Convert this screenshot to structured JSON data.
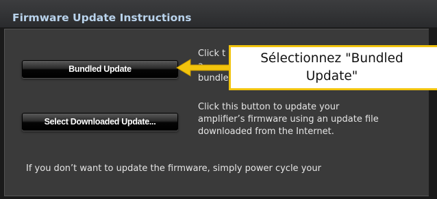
{
  "window": {
    "title": "Firmware Update Instructions"
  },
  "buttons": {
    "bundled_update": "Bundled Update",
    "select_downloaded_update": "Select Downloaded Update..."
  },
  "instructions": {
    "bundled_lines": [
      "Click t",
      "a",
      "bundle"
    ],
    "download_lines": [
      "Click this button to update your",
      "amplifier’s firmware using an update file",
      "downloaded from the Internet."
    ],
    "footer": "If you don’t want to update the firmware, simply power cycle your"
  },
  "callout": {
    "lines": [
      "Sélectionnez \"Bundled",
      "Update\""
    ],
    "border_color": "#f2c40d",
    "arrow_color": "#f2c40d"
  },
  "theme": {
    "title_color": "#b9d3ec",
    "panel_color": "#3a3a3a"
  }
}
